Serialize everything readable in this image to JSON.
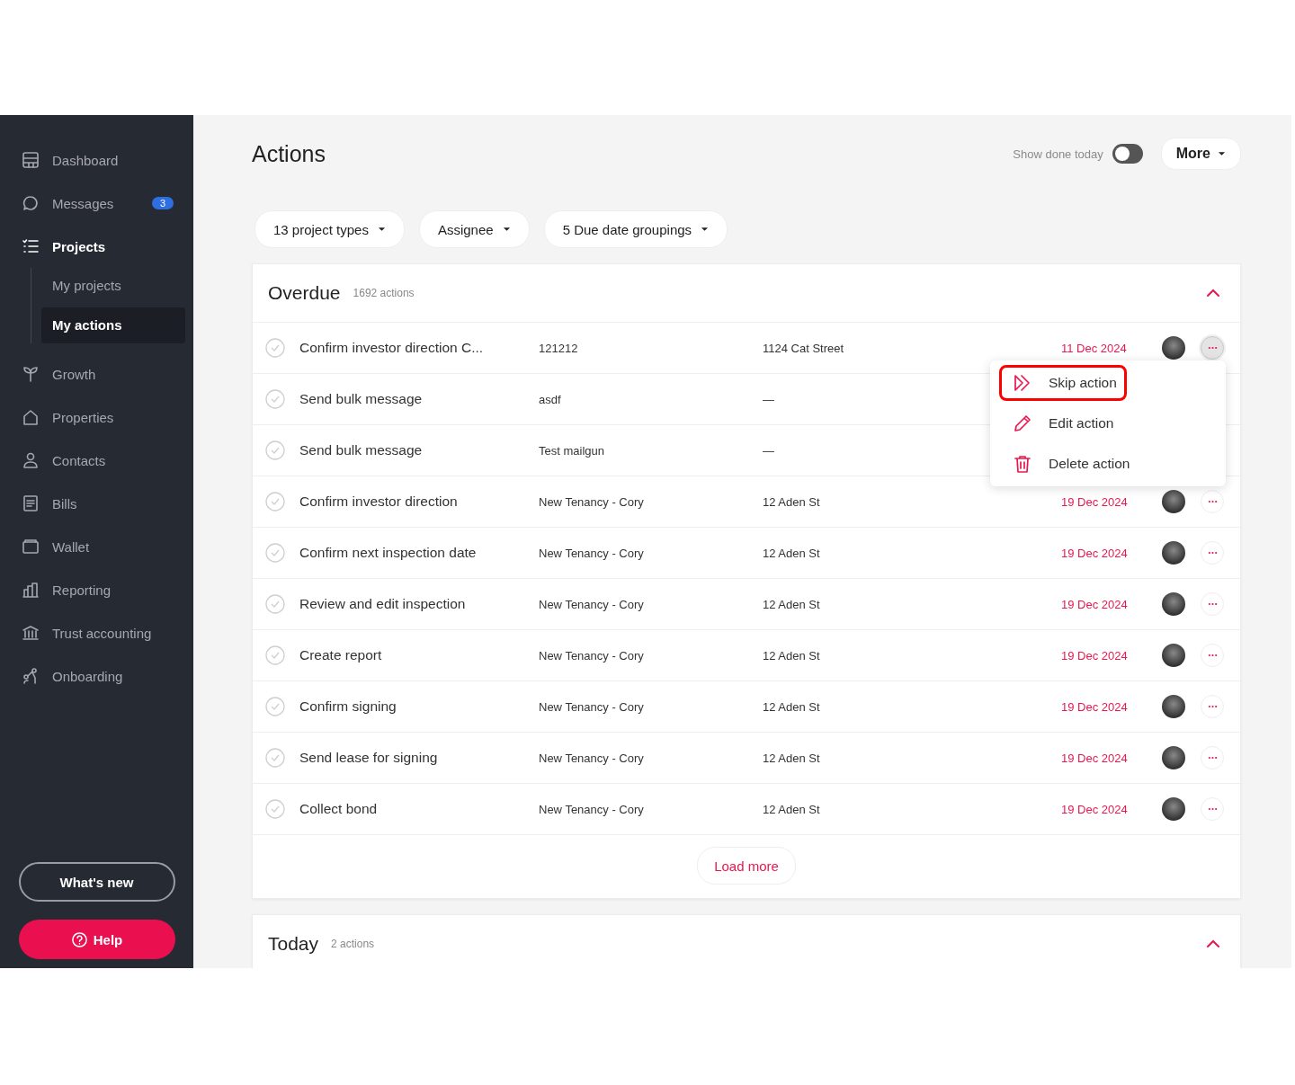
{
  "sidebar": {
    "items": [
      {
        "label": "Dashboard",
        "selected": false
      },
      {
        "label": "Messages",
        "selected": false,
        "badge": "3"
      },
      {
        "label": "Projects",
        "selected": true,
        "children": [
          {
            "label": "My projects",
            "selected": false
          },
          {
            "label": "My actions",
            "selected": true
          }
        ]
      },
      {
        "label": "Growth",
        "selected": false
      },
      {
        "label": "Properties",
        "selected": false
      },
      {
        "label": "Contacts",
        "selected": false
      },
      {
        "label": "Bills",
        "selected": false
      },
      {
        "label": "Wallet",
        "selected": false
      },
      {
        "label": "Reporting",
        "selected": false
      },
      {
        "label": "Trust accounting",
        "selected": false
      },
      {
        "label": "Onboarding",
        "selected": false
      }
    ],
    "whats_new": "What's new",
    "help": "Help"
  },
  "header": {
    "title": "Actions",
    "toggle_label": "Show done today",
    "toggle_on": false,
    "more": "More"
  },
  "filters": [
    "13 project types",
    "Assignee",
    "5 Due date groupings"
  ],
  "sections": [
    {
      "title": "Overdue",
      "count": "1692 actions",
      "expanded": true,
      "load_more": "Load more",
      "rows": [
        {
          "name": "Confirm investor direction C...",
          "project": "121212",
          "property": "1124 Cat Street",
          "date": "11 Dec 2024",
          "menu_open": true,
          "checked": false
        },
        {
          "name": "Send bulk message",
          "project": "asdf",
          "property": "—",
          "checked": false
        },
        {
          "name": "Send bulk message",
          "project": "Test mailgun",
          "property": "—",
          "checked": false
        },
        {
          "name": "Confirm investor direction",
          "project": "New Tenancy - Cory",
          "property": "12 Aden St",
          "date": "19 Dec 2024",
          "menu_open": false,
          "checked": false
        },
        {
          "name": "Confirm next inspection date",
          "project": "New Tenancy - Cory",
          "property": "12 Aden St",
          "date": "19 Dec 2024",
          "menu_open": false,
          "checked": false
        },
        {
          "name": "Review and edit inspection",
          "project": "New Tenancy - Cory",
          "property": "12 Aden St",
          "date": "19 Dec 2024",
          "menu_open": false,
          "checked": false
        },
        {
          "name": "Create report",
          "project": "New Tenancy - Cory",
          "property": "12 Aden St",
          "date": "19 Dec 2024",
          "menu_open": false,
          "checked": false
        },
        {
          "name": "Confirm signing",
          "project": "New Tenancy - Cory",
          "property": "12 Aden St",
          "date": "19 Dec 2024",
          "menu_open": false,
          "checked": false
        },
        {
          "name": "Send lease for signing",
          "project": "New Tenancy - Cory",
          "property": "12 Aden St",
          "date": "19 Dec 2024",
          "menu_open": false,
          "checked": false
        },
        {
          "name": "Collect bond",
          "project": "New Tenancy - Cory",
          "property": "12 Aden St",
          "date": "19 Dec 2024",
          "menu_open": false,
          "checked": false
        }
      ]
    },
    {
      "title": "Today",
      "count": "2 actions",
      "expanded": true
    }
  ],
  "menu": [
    {
      "label": "Skip action",
      "highlighted": true
    },
    {
      "label": "Edit action",
      "highlighted": false
    },
    {
      "label": "Delete action",
      "highlighted": false
    }
  ]
}
